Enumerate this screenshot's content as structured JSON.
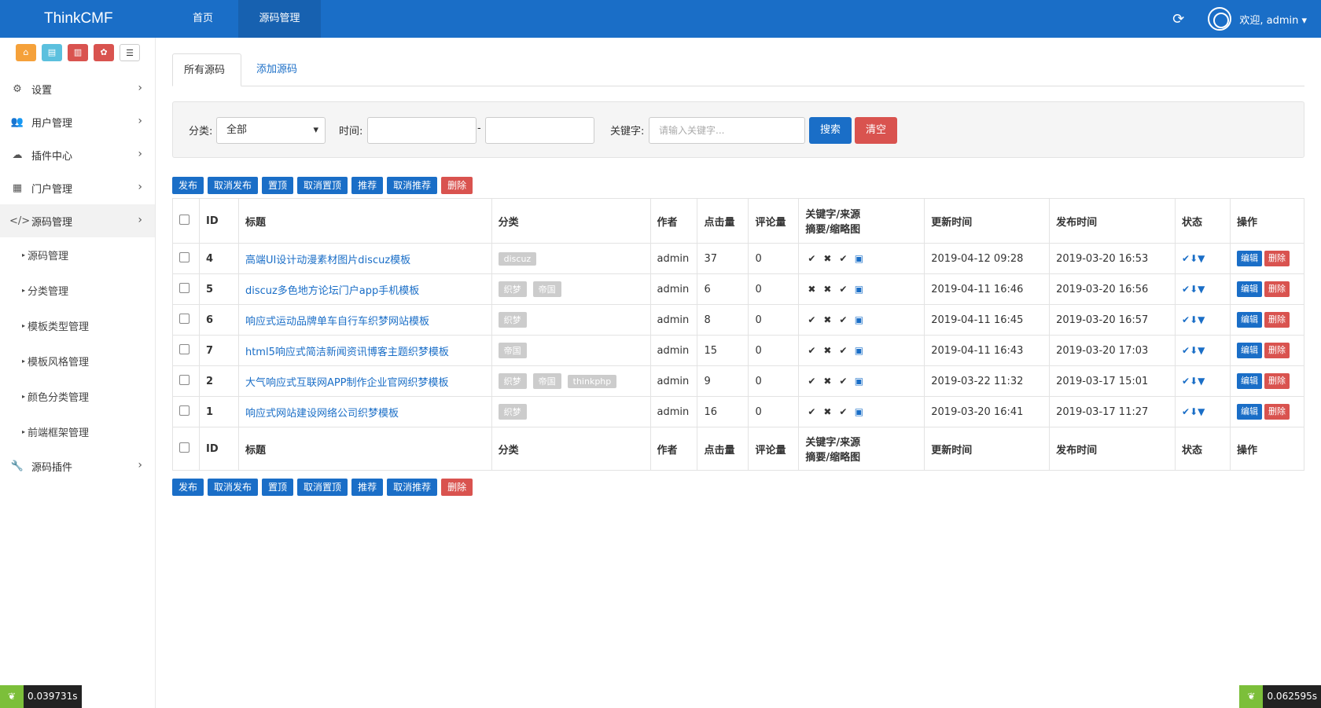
{
  "brand": "ThinkCMF",
  "topnav": [
    "首页",
    "源码管理"
  ],
  "welcome": "欢迎, admin ▾",
  "sidebar": {
    "menu": [
      {
        "icon": "⚙",
        "label": "设置"
      },
      {
        "icon": "👥",
        "label": "用户管理"
      },
      {
        "icon": "☁",
        "label": "插件中心"
      },
      {
        "icon": "▦",
        "label": "门户管理"
      },
      {
        "icon": "</>",
        "label": "源码管理"
      }
    ],
    "sub": [
      "源码管理",
      "分类管理",
      "模板类型管理",
      "模板风格管理",
      "颜色分类管理",
      "前端框架管理"
    ],
    "plugin": {
      "icon": "🔧",
      "label": "源码插件"
    }
  },
  "tabs": [
    "所有源码",
    "添加源码"
  ],
  "filter": {
    "category_label": "分类:",
    "category_value": "全部",
    "time_label": "时间:",
    "dash": "-",
    "keyword_label": "关键字:",
    "keyword_placeholder": "请输入关键字...",
    "search": "搜索",
    "clear": "清空"
  },
  "actions": [
    "发布",
    "取消发布",
    "置顶",
    "取消置顶",
    "推荐",
    "取消推荐",
    "删除"
  ],
  "columns": {
    "id": "ID",
    "title": "标题",
    "category": "分类",
    "author": "作者",
    "hits": "点击量",
    "comments": "评论量",
    "kw1": "关键字/来源",
    "kw2": "摘要/缩略图",
    "updated": "更新时间",
    "published": "发布时间",
    "status": "状态",
    "ops": "操作"
  },
  "rows": [
    {
      "id": "4",
      "title": "高端UI设计动漫素材图片discuz模板",
      "tags": [
        "discuz"
      ],
      "author": "admin",
      "hits": "37",
      "comments": "0",
      "marks": [
        "✔",
        "✖",
        "✔"
      ],
      "updated": "2019-04-12 09:28",
      "published": "2019-03-20 16:53"
    },
    {
      "id": "5",
      "title": "discuz多色地方论坛门户app手机模板",
      "tags": [
        "织梦",
        "帝国"
      ],
      "author": "admin",
      "hits": "6",
      "comments": "0",
      "marks": [
        "✖",
        "✖",
        "✔"
      ],
      "updated": "2019-04-11 16:46",
      "published": "2019-03-20 16:56"
    },
    {
      "id": "6",
      "title": "响应式运动品牌单车自行车织梦网站模板",
      "tags": [
        "织梦"
      ],
      "author": "admin",
      "hits": "8",
      "comments": "0",
      "marks": [
        "✔",
        "✖",
        "✔"
      ],
      "updated": "2019-04-11 16:45",
      "published": "2019-03-20 16:57"
    },
    {
      "id": "7",
      "title": "html5响应式简洁新闻资讯博客主题织梦模板",
      "tags": [
        "帝国"
      ],
      "author": "admin",
      "hits": "15",
      "comments": "0",
      "marks": [
        "✔",
        "✖",
        "✔"
      ],
      "updated": "2019-04-11 16:43",
      "published": "2019-03-20 17:03"
    },
    {
      "id": "2",
      "title": "大气响应式互联网APP制作企业官网织梦模板",
      "tags": [
        "织梦",
        "帝国",
        "thinkphp"
      ],
      "author": "admin",
      "hits": "9",
      "comments": "0",
      "marks": [
        "✔",
        "✖",
        "✔"
      ],
      "updated": "2019-03-22 11:32",
      "published": "2019-03-17 15:01"
    },
    {
      "id": "1",
      "title": "响应式网站建设网络公司织梦模板",
      "tags": [
        "织梦"
      ],
      "author": "admin",
      "hits": "16",
      "comments": "0",
      "marks": [
        "✔",
        "✖",
        "✔"
      ],
      "updated": "2019-03-20 16:41",
      "published": "2019-03-17 11:27"
    }
  ],
  "row_ops": {
    "edit": "编辑",
    "delete": "删除"
  },
  "timing_left": "0.039731s",
  "timing_right": "0.062595s"
}
